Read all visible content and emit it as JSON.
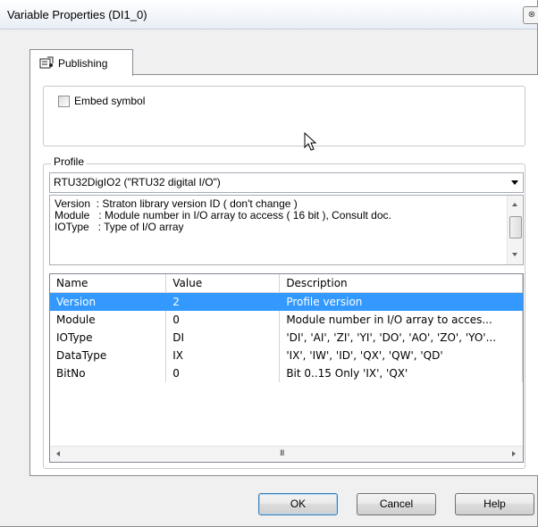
{
  "window": {
    "title": "Variable Properties (DI1_0)",
    "close_glyph": "⊗"
  },
  "tab": {
    "label": "Publishing",
    "icon": "properties-page-icon"
  },
  "embed": {
    "label": "Embed symbol",
    "checked": false
  },
  "profile": {
    "group_label": "Profile",
    "selected": "RTU32DigIO2 (\"RTU32 digital I/O\")",
    "description_lines": [
      "Version  : Straton library version ID ( don't change )",
      "Module   : Module number in I/O array to access ( 16 bit ), Consult doc.",
      "IOType   : Type of I/O array"
    ]
  },
  "grid": {
    "columns": [
      "Name",
      "Value",
      "Description"
    ],
    "rows": [
      {
        "name": "Version",
        "value": "2",
        "description": "Profile version"
      },
      {
        "name": "Module",
        "value": "0",
        "description": "Module number in I/O array to acces..."
      },
      {
        "name": "IOType",
        "value": "DI",
        "description": "'DI', 'AI', 'ZI', 'YI', 'DO', 'AO', 'ZO', 'YO'..."
      },
      {
        "name": "DataType",
        "value": "IX",
        "description": "'IX', 'IW', 'ID', 'QX', 'QW', 'QD'"
      },
      {
        "name": "BitNo",
        "value": "0",
        "description": "Bit 0..15 Only 'IX', 'QX'"
      }
    ],
    "selected_row": 0,
    "scroll_grip": "III"
  },
  "buttons": {
    "ok": "OK",
    "cancel": "Cancel",
    "help": "Help"
  }
}
